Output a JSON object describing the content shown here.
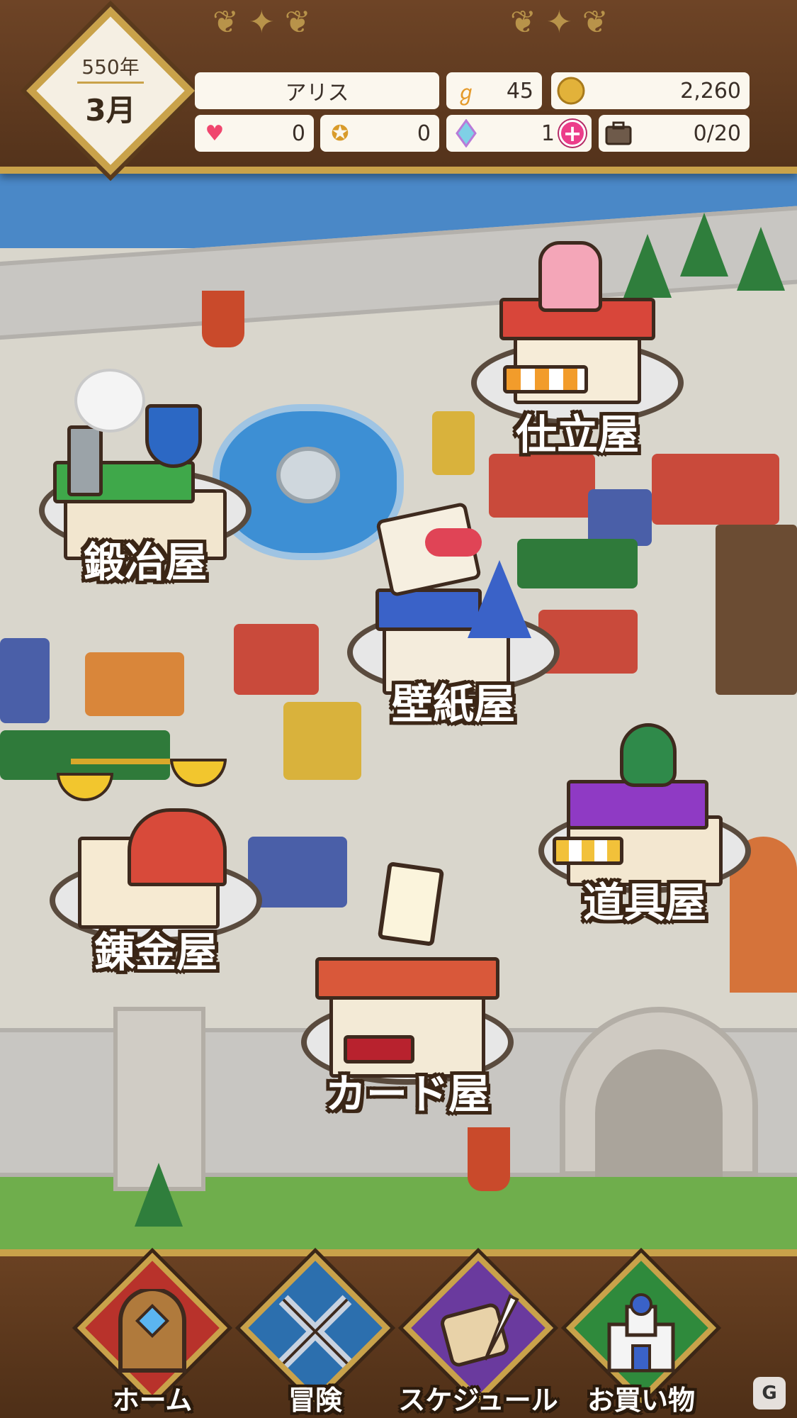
{
  "header": {
    "year": "550年",
    "month": "3月",
    "player_name": "アリス",
    "stamina": "45",
    "gold": "2,260",
    "hearts": "0",
    "medals": "0",
    "crystals": "1",
    "inventory": "0/20",
    "icons": {
      "stamina": "stamina-icon",
      "gold": "gold-coin-icon",
      "hearts": "heart-icon",
      "medals": "winged-medal-icon",
      "crystals": "rainbow-crystal-icon",
      "add": "plus-icon",
      "inventory": "suitcase-icon"
    }
  },
  "shops": {
    "tailor": "仕立屋",
    "blacksmith": "鍛冶屋",
    "wallpaper": "壁紙屋",
    "item": "道具屋",
    "alchemy": "錬金屋",
    "card": "カード屋"
  },
  "nav": {
    "home": "ホーム",
    "adventure": "冒険",
    "schedule": "スケジュール",
    "shop": "お買い物"
  },
  "colors": {
    "frame_wood": "#5a3a1c",
    "frame_gold": "#c9a24a",
    "home_tile": "#b8322b",
    "adventure_tile": "#2c6fae",
    "schedule_tile": "#6a3a9e",
    "shop_tile": "#2f8a3c"
  }
}
